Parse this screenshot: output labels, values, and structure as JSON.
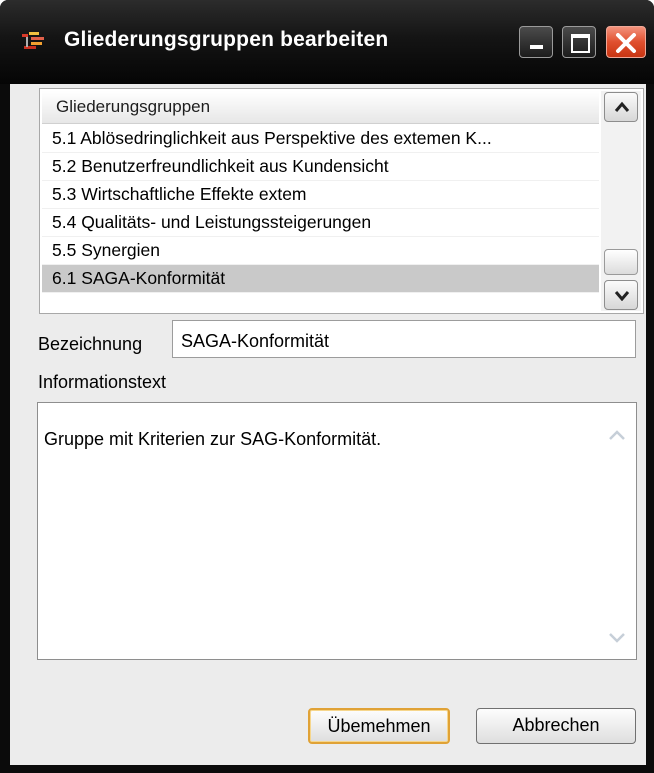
{
  "window": {
    "title": "Gliederungsgruppen bearbeiten",
    "icons": {
      "app": "tree-structure-icon",
      "minimize": "minimize-icon",
      "maximize": "maximize-icon",
      "close": "close-icon"
    }
  },
  "list": {
    "header": "Gliederungsgruppen",
    "items": [
      {
        "label": "5.1 Ablösedringlichkeit aus Perspektive des extemen K...",
        "selected": false
      },
      {
        "label": "5.2 Benutzerfreundlichkeit aus Kundensicht",
        "selected": false
      },
      {
        "label": "5.3 Wirtschaftliche Effekte extem",
        "selected": false
      },
      {
        "label": "5.4 Qualitäts- und Leistungssteigerungen",
        "selected": false
      },
      {
        "label": "5.5 Synergien",
        "selected": false
      },
      {
        "label": "6.1 SAGA-Konformität",
        "selected": true
      }
    ]
  },
  "form": {
    "bezeichnung_label": "Bezeichnung",
    "bezeichnung_value": "SAGA-Konformität",
    "informationstext_label": "Informationstext",
    "informationstext_value": "Gruppe mit Kriterien zur SAG-Konformität."
  },
  "buttons": {
    "apply_label": "Übemehmen",
    "cancel_label": "Abbrechen"
  },
  "colors": {
    "titlebar": "#0b0b0b",
    "close_button": "#e0502f",
    "selected_row": "#c9c9c9",
    "default_button_border": "#e0a236"
  }
}
